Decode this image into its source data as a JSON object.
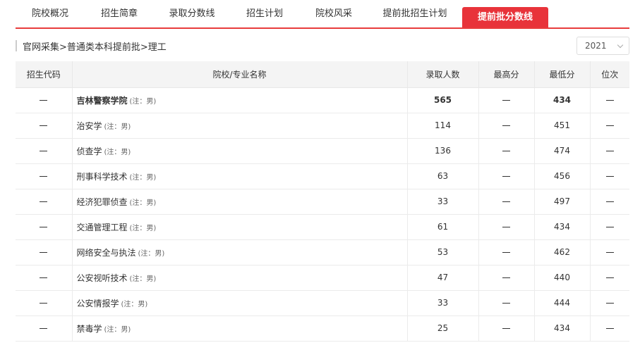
{
  "tabs": [
    {
      "label": "院校概况",
      "active": false
    },
    {
      "label": "招生简章",
      "active": false
    },
    {
      "label": "录取分数线",
      "active": false
    },
    {
      "label": "招生计划",
      "active": false
    },
    {
      "label": "院校风采",
      "active": false
    },
    {
      "label": "提前批招生计划",
      "active": false
    },
    {
      "label": "提前批分数线",
      "active": true
    }
  ],
  "breadcrumb": "官网采集>普通类本科提前批>理工",
  "year_select": {
    "value": "2021"
  },
  "table": {
    "headers": [
      "招生代码",
      "院校/专业名称",
      "录取人数",
      "最高分",
      "最低分",
      "位次"
    ],
    "rows": [
      {
        "name": "吉林警察学院",
        "note": "(注：男)",
        "count": "565",
        "min": "434",
        "bold": true
      },
      {
        "name": "治安学",
        "note": "(注：男)",
        "count": "114",
        "min": "451",
        "bold": false
      },
      {
        "name": "侦查学",
        "note": "(注：男)",
        "count": "136",
        "min": "474",
        "bold": false
      },
      {
        "name": "刑事科学技术",
        "note": "(注：男)",
        "count": "63",
        "min": "456",
        "bold": false
      },
      {
        "name": "经济犯罪侦查",
        "note": "(注：男)",
        "count": "33",
        "min": "497",
        "bold": false
      },
      {
        "name": "交通管理工程",
        "note": "(注：男)",
        "count": "61",
        "min": "434",
        "bold": false
      },
      {
        "name": "网络安全与执法",
        "note": "(注：男)",
        "count": "53",
        "min": "462",
        "bold": false
      },
      {
        "name": "公安视听技术",
        "note": "(注：男)",
        "count": "47",
        "min": "440",
        "bold": false
      },
      {
        "name": "公安情报学",
        "note": "(注：男)",
        "count": "33",
        "min": "444",
        "bold": false
      },
      {
        "name": "禁毒学",
        "note": "(注：男)",
        "count": "25",
        "min": "434",
        "bold": false
      }
    ]
  }
}
